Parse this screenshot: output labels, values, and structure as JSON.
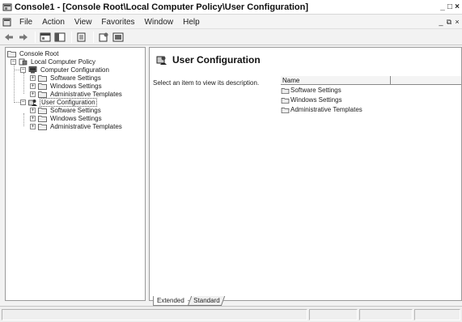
{
  "window": {
    "title": "Console1 - [Console Root\\Local Computer Policy\\User Configuration]",
    "controls": {
      "minimize": "_",
      "maximize": "□",
      "close": "×"
    },
    "child_controls": {
      "minimize": "_",
      "restore": "⧉",
      "close": "×"
    }
  },
  "menubar": {
    "items": [
      {
        "label": "File",
        "accel": "F"
      },
      {
        "label": "Action",
        "accel": "A"
      },
      {
        "label": "View",
        "accel": "V"
      },
      {
        "label": "Favorites",
        "accel": "o"
      },
      {
        "label": "Window",
        "accel": "W"
      },
      {
        "label": "Help",
        "accel": "H"
      }
    ]
  },
  "toolbar": {
    "buttons": [
      "back-arrow-icon",
      "forward-arrow-icon",
      "up-folder-icon",
      "show-hide-tree-icon",
      "export-list-icon",
      "properties-icon",
      "help-icon"
    ]
  },
  "tree": {
    "nodes": [
      {
        "label": "Console Root",
        "icon": "folder-icon",
        "level": 0,
        "expander": ""
      },
      {
        "label": "Local Computer Policy",
        "icon": "policy-icon",
        "level": 1,
        "expander": "−"
      },
      {
        "label": "Computer Configuration",
        "icon": "computer-icon",
        "level": 2,
        "expander": "−"
      },
      {
        "label": "Software Settings",
        "icon": "folder-icon",
        "level": 3,
        "expander": "+"
      },
      {
        "label": "Windows Settings",
        "icon": "folder-icon",
        "level": 3,
        "expander": "+"
      },
      {
        "label": "Administrative Templates",
        "icon": "folder-icon",
        "level": 3,
        "expander": "+"
      },
      {
        "label": "User Configuration",
        "icon": "user-icon",
        "level": 2,
        "expander": "−",
        "selected": true
      },
      {
        "label": "Software Settings",
        "icon": "folder-icon",
        "level": 3,
        "expander": "+"
      },
      {
        "label": "Windows Settings",
        "icon": "folder-icon",
        "level": 3,
        "expander": "+"
      },
      {
        "label": "Administrative Templates",
        "icon": "folder-icon",
        "level": 3,
        "expander": "+"
      }
    ]
  },
  "details": {
    "title": "User Configuration",
    "description": "Select an item to view its description.",
    "column_header": "Name",
    "items": [
      "Software Settings",
      "Windows Settings",
      "Administrative Templates"
    ]
  },
  "tabs": {
    "extended": "Extended",
    "standard": "Standard"
  }
}
